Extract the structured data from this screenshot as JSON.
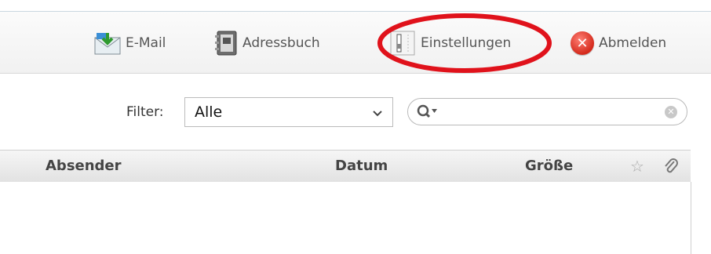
{
  "toolbar": {
    "email_label": "E-Mail",
    "addressbook_label": "Adressbuch",
    "settings_label": "Einstellungen",
    "logout_label": "Abmelden"
  },
  "filter": {
    "label": "Filter:",
    "selected": "Alle"
  },
  "search": {
    "value": ""
  },
  "list": {
    "columns": [
      "Absender",
      "Datum",
      "Größe"
    ]
  },
  "colors": {
    "annotation": "#e0121b",
    "logout": "#d42a1c"
  }
}
